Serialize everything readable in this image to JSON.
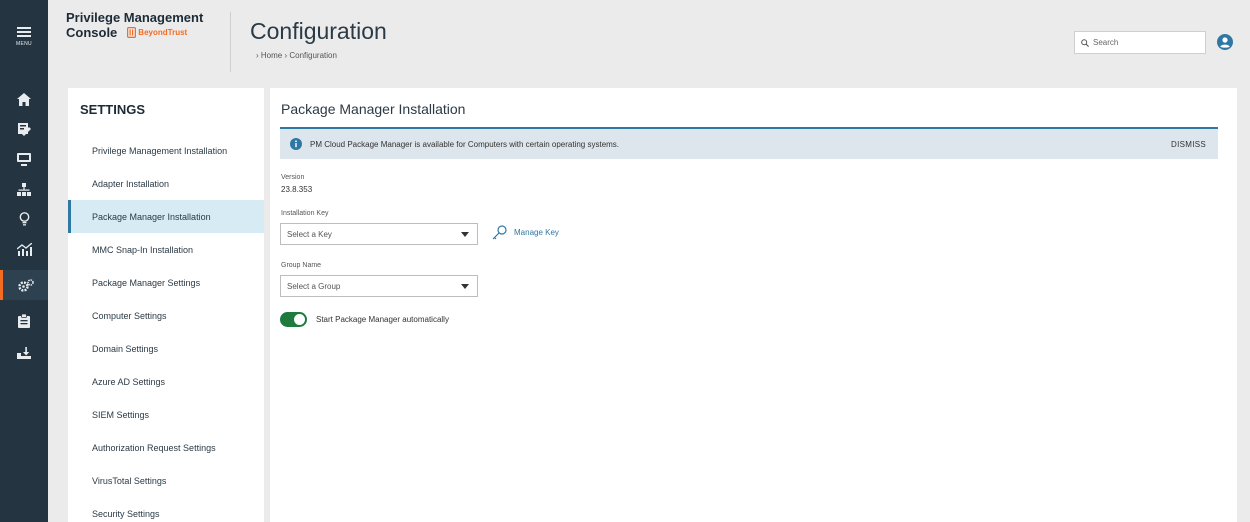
{
  "rail": {
    "menu_label": "MENU",
    "items": [
      {
        "icon": "home-icon"
      },
      {
        "icon": "policy-icon"
      },
      {
        "icon": "computer-icon"
      },
      {
        "icon": "groups-icon"
      },
      {
        "icon": "lightbulb-icon"
      },
      {
        "icon": "analytics-icon"
      },
      {
        "icon": "configuration-icon",
        "active": true
      },
      {
        "icon": "clipboard-icon"
      },
      {
        "icon": "download-icon"
      }
    ]
  },
  "header": {
    "brand_line1": "Privilege Management",
    "brand_line2": "Console",
    "brand_logo": "BeyondTrust",
    "title": "Configuration",
    "breadcrumb": "›  Home  ›  Configuration",
    "search_placeholder": "Search"
  },
  "settings": {
    "title": "SETTINGS",
    "items": [
      {
        "label": "Privilege Management Installation"
      },
      {
        "label": "Adapter Installation"
      },
      {
        "label": "Package Manager Installation",
        "active": true
      },
      {
        "label": "MMC Snap-In Installation"
      },
      {
        "label": "Package Manager Settings"
      },
      {
        "label": "Computer Settings"
      },
      {
        "label": "Domain Settings"
      },
      {
        "label": "Azure AD Settings"
      },
      {
        "label": "SIEM Settings"
      },
      {
        "label": "Authorization Request Settings"
      },
      {
        "label": "VirusTotal Settings"
      },
      {
        "label": "Security Settings"
      }
    ]
  },
  "main": {
    "title": "Package Manager Installation",
    "banner_text": "PM Cloud Package Manager is available for Computers with certain operating systems.",
    "dismiss_label": "DISMISS",
    "version_label": "Version",
    "version_value": "23.8.353",
    "install_key_label": "Installation Key",
    "install_key_selected": "Select a Key",
    "manage_key_label": "Manage Key",
    "group_label": "Group Name",
    "group_selected": "Select a Group",
    "toggle_label": "Start Package Manager automatically",
    "toggle_on": true
  },
  "colors": {
    "rail_bg": "#243441",
    "accent_blue": "#2f78a4",
    "brand_orange": "#f46b22",
    "toggle_green": "#1e7a3d"
  }
}
